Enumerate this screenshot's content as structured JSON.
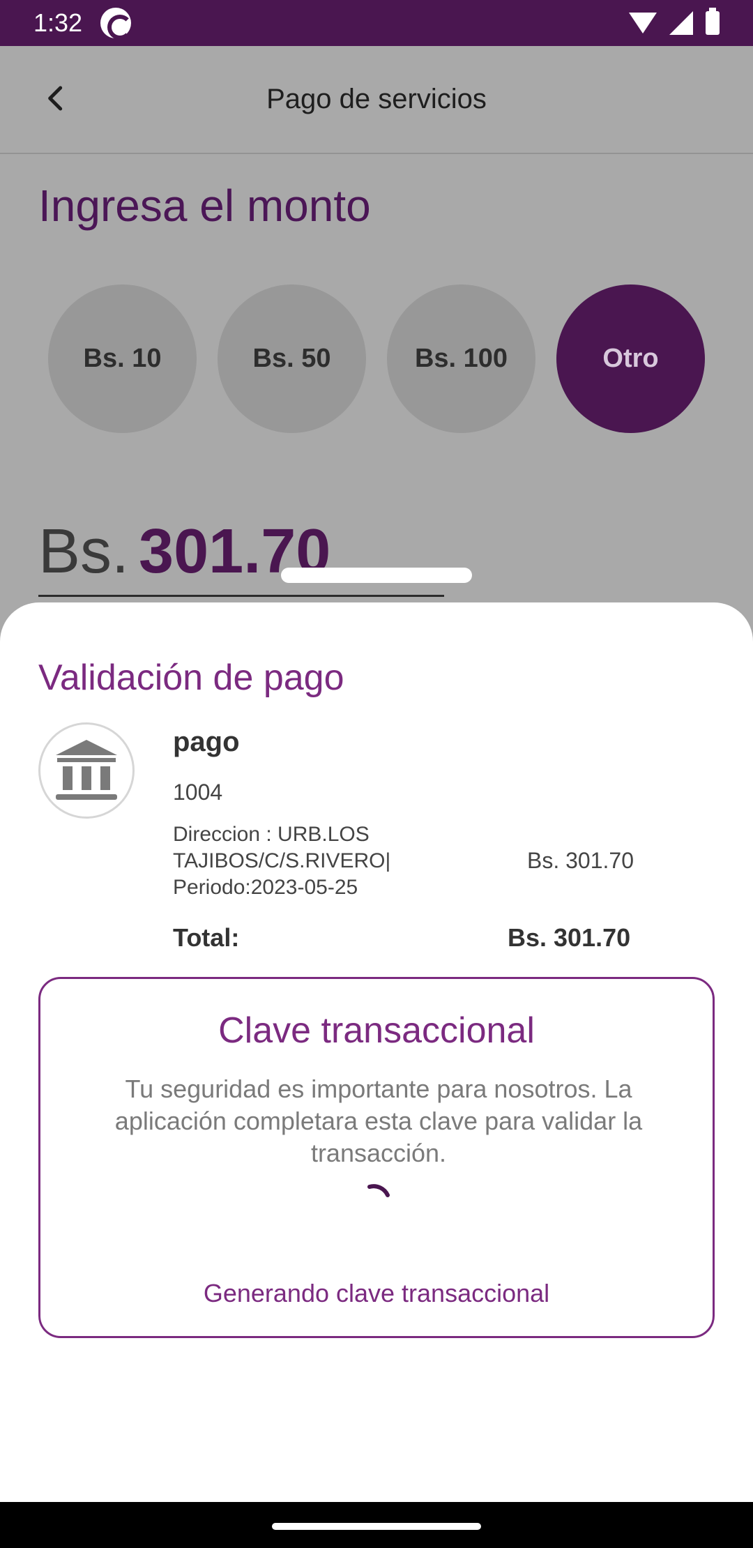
{
  "status_bar": {
    "time": "1:32"
  },
  "app_bar": {
    "title": "Pago de servicios"
  },
  "amount": {
    "heading": "Ingresa el monto",
    "options": [
      "Bs. 10",
      "Bs. 50",
      "Bs. 100",
      "Otro"
    ],
    "selected_option": "Otro",
    "currency": "Bs.",
    "value": "301.70"
  },
  "sheet": {
    "title": "Validación de pago",
    "payment": {
      "name": "pago",
      "code": "1004",
      "detail_line1": "Direccion : URB.LOS",
      "detail_line2": "TAJIBOS/C/S.RIVERO|",
      "detail_line3": "Periodo:2023-05-25",
      "amount": "Bs. 301.70"
    },
    "total_label": "Total:",
    "total_value": "Bs. 301.70",
    "key_card": {
      "title": "Clave transaccional",
      "description": "Tu seguridad es importante para nosotros. La aplicación completara esta clave para validar la transacción.",
      "status": "Generando clave transaccional"
    }
  },
  "colors": {
    "primary": "#4a1650",
    "accent": "#7b2a80",
    "scrim": "#a9a9a9"
  }
}
